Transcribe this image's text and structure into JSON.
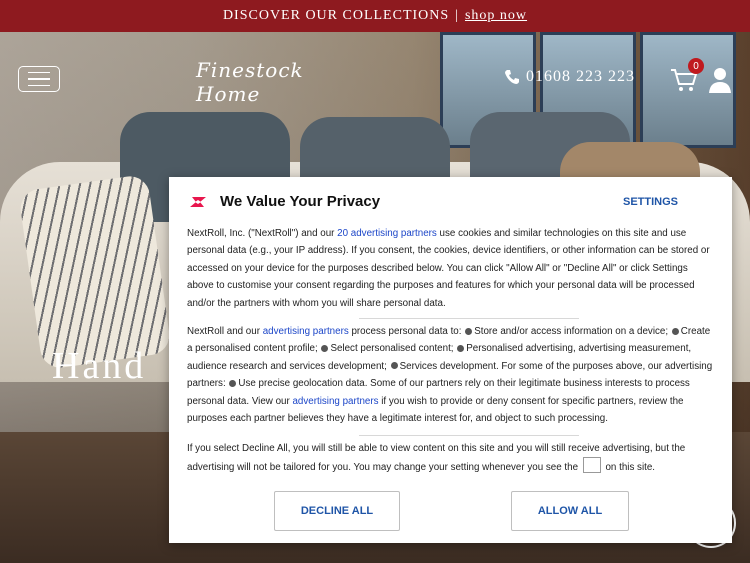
{
  "promo": {
    "text": "DISCOVER OUR COLLECTIONS",
    "separator": "|",
    "link": "shop now"
  },
  "header": {
    "logo_text": "Finestock Home",
    "phone": "01608 223 223",
    "cart_count": "0"
  },
  "hero": {
    "title_visible": "Hand"
  },
  "consent": {
    "title": "We Value Your Privacy",
    "settings_label": "SETTINGS",
    "p1_a": "NextRoll, Inc. (\"NextRoll\") and our ",
    "p1_link": "20 advertising partners",
    "p1_b": " use cookies and similar technologies on this site and use personal data (e.g., your IP address). If you consent, the cookies, device identifiers, or other information can be stored or accessed on your device for the purposes described below. You can click \"Allow All\" or \"Decline All\" or click Settings above to customise your consent regarding the purposes and features for which your personal data will be processed and/or the partners with whom you will share personal data.",
    "p2_a": "NextRoll and our ",
    "p2_link1": "advertising partners",
    "p2_b": " process personal data to: ",
    "p2_items": [
      "Store and/or access information on a device; ",
      "Create a personalised content profile; ",
      "Select personalised content; ",
      "Personalised advertising, advertising measurement, audience research and services development; ",
      "Services development. For some of the purposes above, our advertising partners: ",
      "Use precise geolocation data. Some of our partners rely on their legitimate business interests to process personal data. View our "
    ],
    "p2_link2": "advertising partners",
    "p2_c": " if you wish to provide or deny consent for specific partners, review the purposes each partner believes they have a legitimate interest for, and object to such processing.",
    "p3_a": "If you select Decline All, you will still be able to view content on this site and you will still receive advertising, but the advertising will not be tailored for you. You may change your setting whenever you see the ",
    "p3_b": " on this site.",
    "decline_label": "DECLINE ALL",
    "allow_label": "ALLOW ALL",
    "brand_color": "#e8164d",
    "link_color": "#1c46c8"
  }
}
